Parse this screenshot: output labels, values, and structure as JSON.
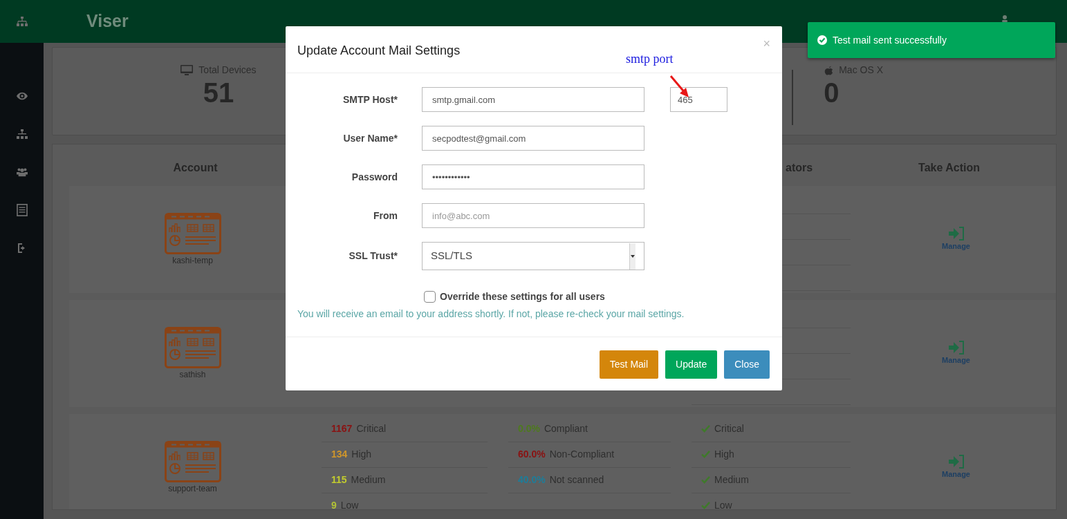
{
  "app": {
    "title": "Viser"
  },
  "summary": [
    {
      "kind": "monitor",
      "label": "Total Devices",
      "value": "51"
    },
    {
      "kind": "apple",
      "label": "Mac OS X",
      "value": "0"
    }
  ],
  "table": {
    "columns": [
      "Account",
      "ators",
      "Take Action"
    ],
    "rows": [
      {
        "account": "kashi-temp",
        "action": "Manage"
      },
      {
        "account": "sathish",
        "action": "Manage"
      },
      {
        "account": "support-team",
        "action": "Manage",
        "severities": [
          {
            "count": "1167",
            "label": "Critical",
            "color": "#8a1212"
          },
          {
            "count": "134",
            "label": "High",
            "color": "#d0962a"
          },
          {
            "count": "115",
            "label": "Medium",
            "color": "#c2cc2e"
          },
          {
            "count": "9",
            "label": "Low",
            "color": "#b2c236"
          }
        ],
        "compliance": [
          {
            "count": "0.0%",
            "label": "Compliant",
            "color": "#4e7a1e"
          },
          {
            "count": "60.0%",
            "label": "Non-Compliant",
            "color": "#8a1212"
          },
          {
            "count": "40.0%",
            "label": "Not scanned",
            "color": "#1d7d9a"
          }
        ],
        "indicators": [
          "Critical",
          "High",
          "Medium",
          "Low"
        ]
      }
    ]
  },
  "modal": {
    "title": "Update Account Mail Settings",
    "close_label": "×",
    "annotation": "smtp port",
    "fields": [
      {
        "kind": "text",
        "label": "SMTP Host*",
        "value": "smtp.gmail.com",
        "port": "465"
      },
      {
        "kind": "text",
        "label": "User Name*",
        "value": "secpodtest@gmail.com"
      },
      {
        "kind": "text",
        "label": "Password",
        "value": "••••••••••••"
      },
      {
        "kind": "text",
        "label": "From",
        "placeholder": "info@abc.com"
      },
      {
        "kind": "select",
        "label": "SSL Trust*",
        "value": "SSL/TLS"
      }
    ],
    "checkbox": {
      "label": "Override these settings for all users",
      "checked": false
    },
    "note": "You will receive an email to your address shortly. If not, please re-check your mail settings.",
    "buttons": [
      {
        "kind": "warning",
        "label": "Test Mail"
      },
      {
        "kind": "success",
        "label": "Update"
      },
      {
        "kind": "primary",
        "label": "Close"
      }
    ]
  },
  "toast": {
    "message": "Test mail sent successfully"
  }
}
